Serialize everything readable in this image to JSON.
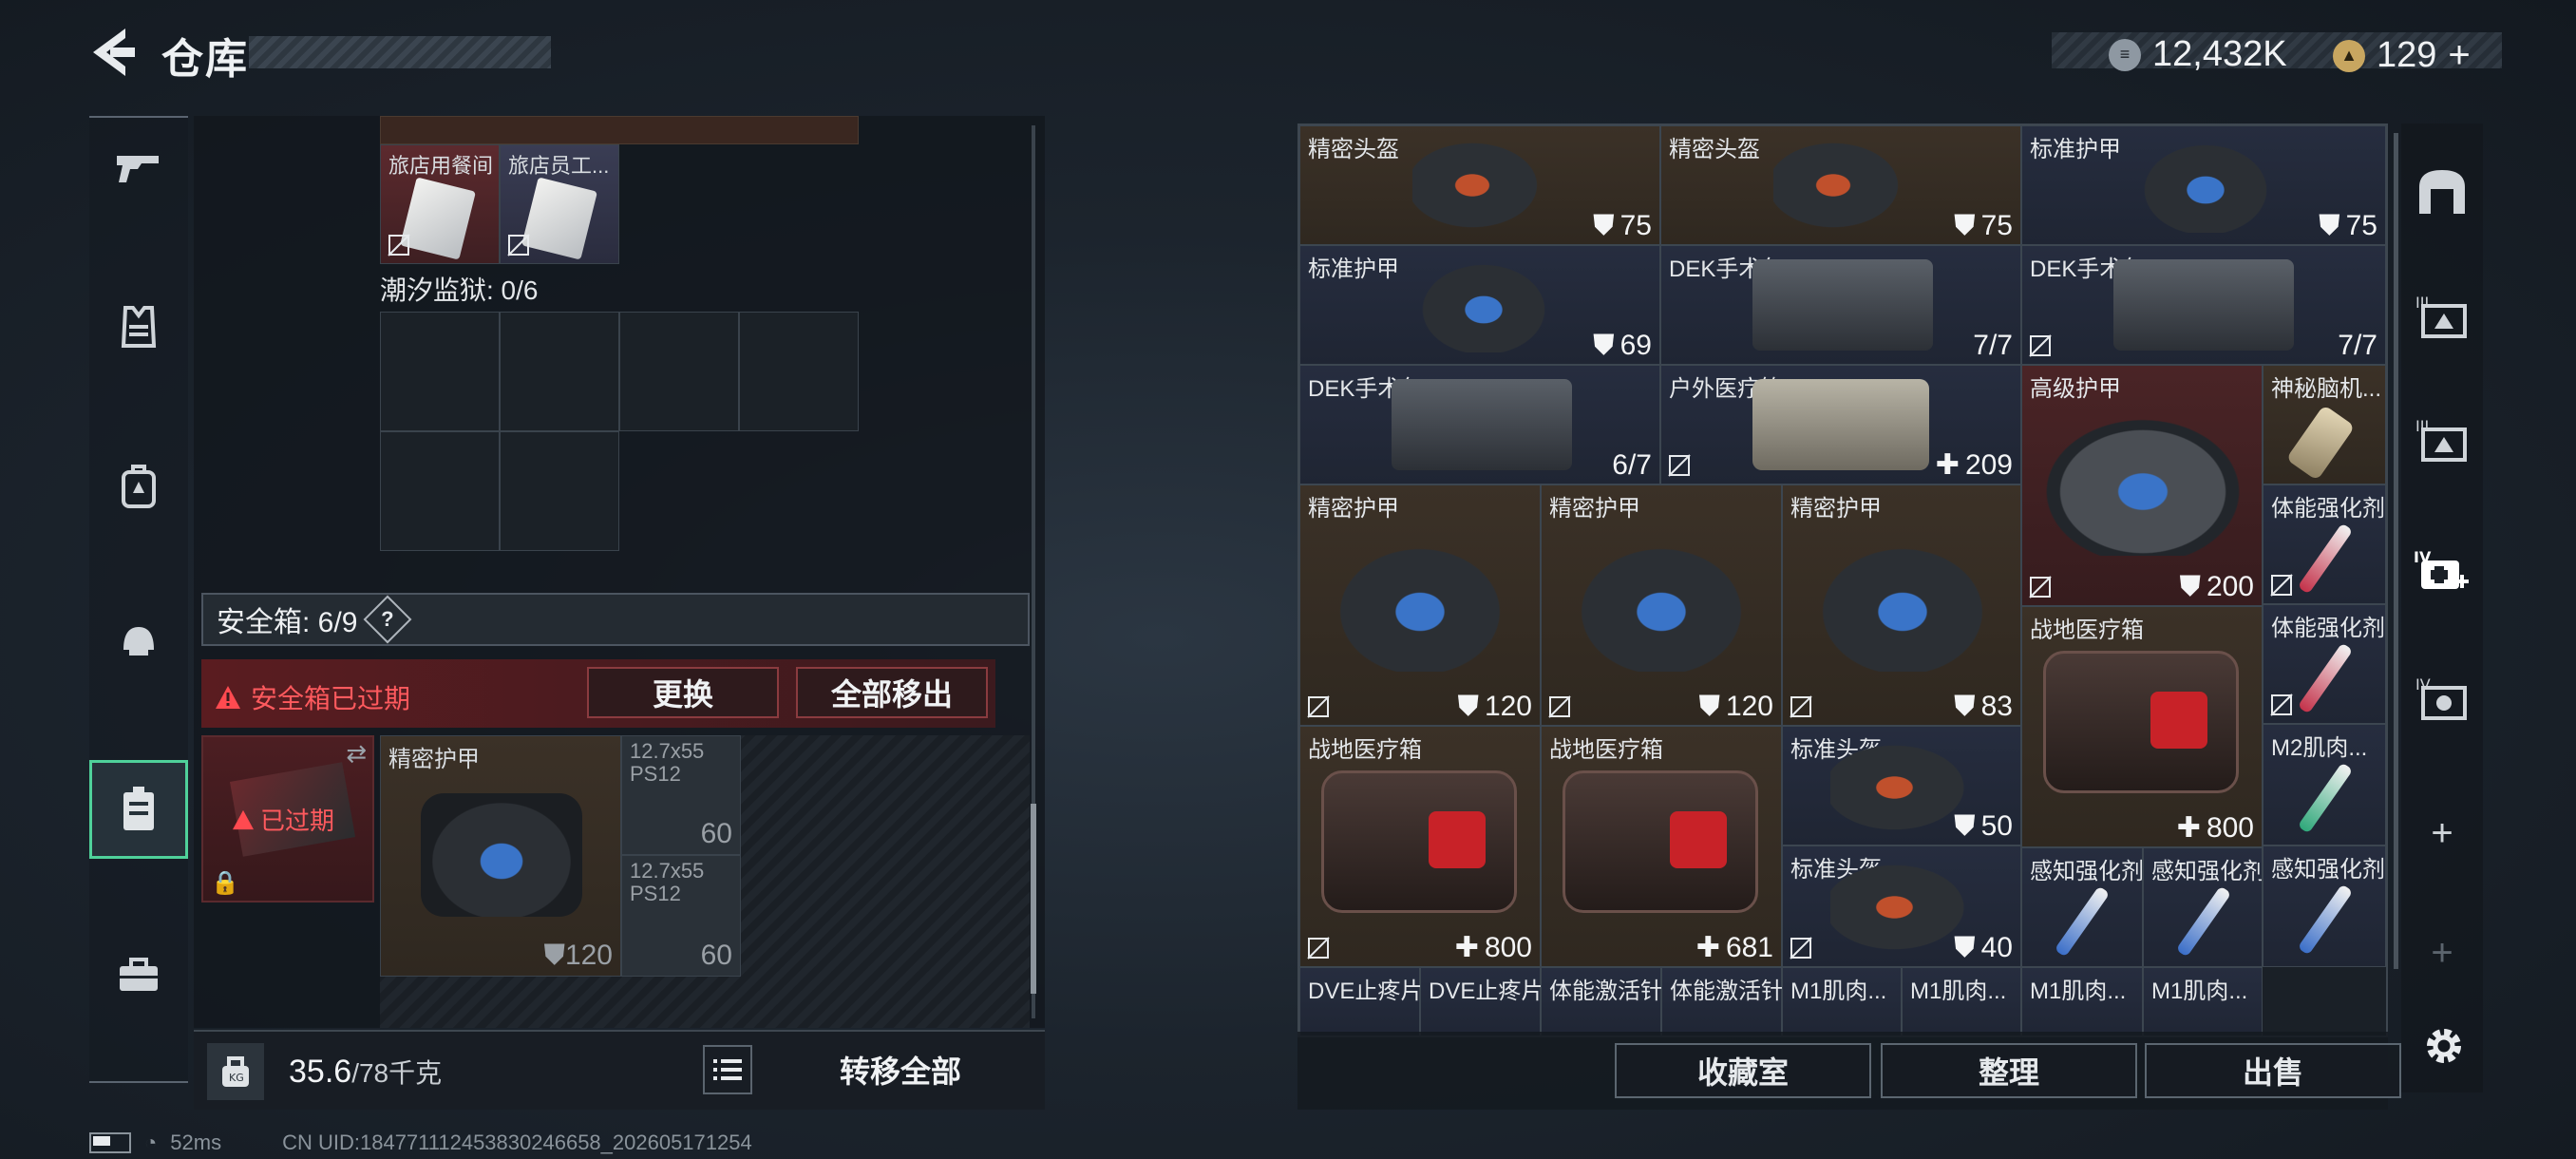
{
  "header": {
    "title": "仓库"
  },
  "currency": {
    "coins": "12,432K",
    "tickets": "129"
  },
  "left": {
    "stash_labels": [
      "旅店用餐间",
      "旅店员工..."
    ],
    "prison_label": "潮汐监狱: 0/6",
    "safebox_label": "安全箱: 6/9",
    "help": "?",
    "expired_warning": "安全箱已过期",
    "replace_button": "更换",
    "move_all_out_button": "全部移出",
    "box_expired": "已过期",
    "items": [
      {
        "name": "精密护甲",
        "value": "120"
      },
      {
        "name": "12.7x55 PS12",
        "value": "60"
      },
      {
        "name": "12.7x55 PS12",
        "value": "60"
      }
    ],
    "weight": "35.6",
    "weight_max": "/78千克",
    "transfer_all": "转移全部"
  },
  "grid": {
    "items": [
      {
        "name": "精密头盔",
        "value": "75",
        "icon": "shield"
      },
      {
        "name": "精密头盔",
        "value": "75",
        "icon": "shield"
      },
      {
        "name": "标准护甲",
        "value": "75",
        "icon": "shield"
      },
      {
        "name": "标准护甲",
        "value": "69",
        "icon": "shield"
      },
      {
        "name": "DEK手术包",
        "value": "7/7",
        "icon": ""
      },
      {
        "name": "DEK手术包",
        "value": "7/7",
        "icon": ""
      },
      {
        "name": "DEK手术包",
        "value": "6/7",
        "icon": ""
      },
      {
        "name": "户外医疗箱",
        "value": "209",
        "icon": "plus"
      },
      {
        "name": "高级护甲",
        "value": "200",
        "icon": "shield"
      },
      {
        "name": "神秘脑机...",
        "value": "",
        "icon": ""
      },
      {
        "name": "精密护甲",
        "value": "120",
        "icon": "shield"
      },
      {
        "name": "精密护甲",
        "value": "120",
        "icon": "shield"
      },
      {
        "name": "精密护甲",
        "value": "83",
        "icon": "shield"
      },
      {
        "name": "体能强化剂",
        "value": "",
        "icon": ""
      },
      {
        "name": "战地医疗箱",
        "value": "800",
        "icon": "plus"
      },
      {
        "name": "体能强化剂",
        "value": "",
        "icon": ""
      },
      {
        "name": "战地医疗箱",
        "value": "800",
        "icon": "plus"
      },
      {
        "name": "战地医疗箱",
        "value": "681",
        "icon": "plus"
      },
      {
        "name": "标准头盔",
        "value": "50",
        "icon": "shield"
      },
      {
        "name": "M2肌肉...",
        "value": "",
        "icon": ""
      },
      {
        "name": "标准头盔",
        "value": "40",
        "icon": "shield"
      },
      {
        "name": "感知强化剂",
        "value": "",
        "icon": ""
      },
      {
        "name": "感知强化剂",
        "value": "",
        "icon": ""
      },
      {
        "name": "感知强化剂",
        "value": "",
        "icon": ""
      },
      {
        "name": "DVE止疼片",
        "value": "",
        "icon": ""
      },
      {
        "name": "DVE止疼片",
        "value": "",
        "icon": ""
      },
      {
        "name": "体能激活针",
        "value": "",
        "icon": ""
      },
      {
        "name": "体能激活针",
        "value": "",
        "icon": ""
      },
      {
        "name": "M1肌肉...",
        "value": "",
        "icon": ""
      },
      {
        "name": "M1肌肉...",
        "value": "",
        "icon": ""
      },
      {
        "name": "M1肌肉...",
        "value": "",
        "icon": ""
      },
      {
        "name": "M1肌肉...",
        "value": "",
        "icon": ""
      }
    ]
  },
  "bottom": {
    "collection": "收藏室",
    "sort": "整理",
    "sell": "出售"
  },
  "status": {
    "ping": "52ms",
    "uid": "CN UID:184771112453830246658_202605171254"
  },
  "colors": {
    "accent": "#4fd19a",
    "warning": "#e0454a",
    "brown_cell": "#3b3127",
    "navy_cell": "#262d3f",
    "red_cell": "#4a2426"
  }
}
